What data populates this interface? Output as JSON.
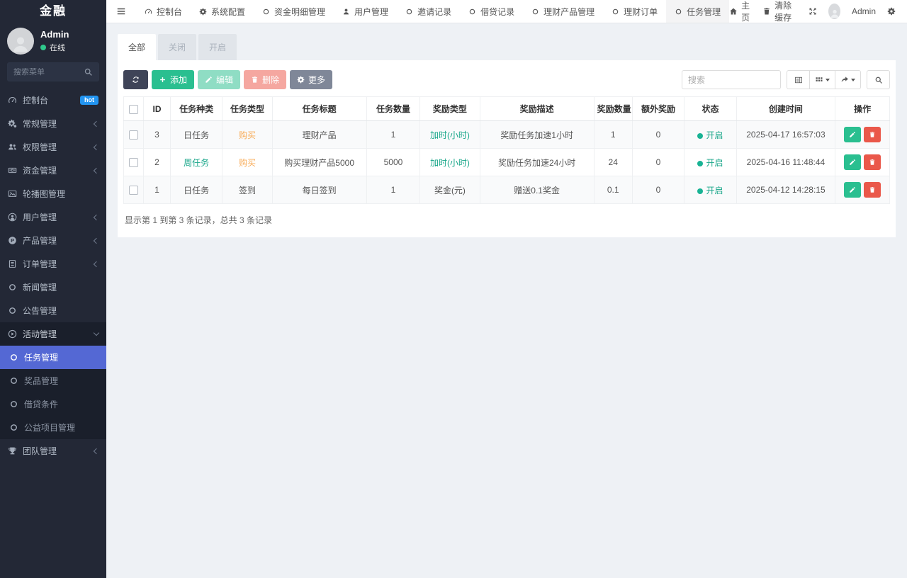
{
  "app": {
    "title": "金融"
  },
  "colors": {
    "accent_green": "#2abf90",
    "accent_red": "#ec584b",
    "accent_orange": "#f8ac59",
    "active_blue": "#5468d4",
    "hot_badge_blue": "#2395f1",
    "status_green": "#18a689",
    "sidebar_bg": "#232836"
  },
  "sidebar": {
    "user": {
      "name": "Admin",
      "status": "在线"
    },
    "search_placeholder": "搜索菜单",
    "items": [
      {
        "id": "dashboard",
        "label": "控制台",
        "icon": "dashboard-icon",
        "badge": "hot"
      },
      {
        "id": "general",
        "label": "常规管理",
        "icon": "cogs-icon",
        "chevron": "left"
      },
      {
        "id": "permission",
        "label": "权限管理",
        "icon": "users-icon",
        "chevron": "left"
      },
      {
        "id": "funds",
        "label": "资金管理",
        "icon": "money-icon",
        "chevron": "left"
      },
      {
        "id": "banner",
        "label": "轮播图管理",
        "icon": "image-icon"
      },
      {
        "id": "users",
        "label": "用户管理",
        "icon": "user-circle-icon",
        "chevron": "left"
      },
      {
        "id": "products",
        "label": "产品管理",
        "icon": "product-icon",
        "chevron": "left"
      },
      {
        "id": "orders",
        "label": "订单管理",
        "icon": "order-icon",
        "chevron": "left"
      },
      {
        "id": "news",
        "label": "新闻管理",
        "icon": "circle-icon"
      },
      {
        "id": "notice",
        "label": "公告管理",
        "icon": "circle-icon"
      },
      {
        "id": "activity",
        "label": "活动管理",
        "icon": "play-circle-icon",
        "chevron": "down",
        "expanded": true,
        "children": [
          {
            "id": "tasks",
            "label": "任务管理",
            "icon": "circle-icon",
            "active": true
          },
          {
            "id": "prizes",
            "label": "奖品管理",
            "icon": "circle-icon"
          },
          {
            "id": "loan-terms",
            "label": "借贷条件",
            "icon": "circle-icon"
          },
          {
            "id": "charity",
            "label": "公益项目管理",
            "icon": "circle-icon"
          }
        ]
      },
      {
        "id": "team",
        "label": "团队管理",
        "icon": "trophy-icon",
        "chevron": "left"
      }
    ]
  },
  "topnav": {
    "tabs": [
      {
        "id": "dashboard",
        "label": "控制台",
        "icon": "dashboard-icon"
      },
      {
        "id": "system-config",
        "label": "系统配置",
        "icon": "gear-icon"
      },
      {
        "id": "fund-details",
        "label": "资金明细管理",
        "icon": "circle-icon"
      },
      {
        "id": "user-mgmt",
        "label": "用户管理",
        "icon": "person-icon"
      },
      {
        "id": "invite-records",
        "label": "邀请记录",
        "icon": "circle-icon"
      },
      {
        "id": "loan-records",
        "label": "借贷记录",
        "icon": "circle-icon"
      },
      {
        "id": "wealth-products",
        "label": "理财产品管理",
        "icon": "circle-icon"
      },
      {
        "id": "wealth-orders",
        "label": "理财订单",
        "icon": "circle-icon"
      },
      {
        "id": "task-mgmt",
        "label": "任务管理",
        "icon": "circle-icon",
        "active": true
      }
    ],
    "right": {
      "home": "主页",
      "clear_cache": "清除缓存",
      "user": "Admin"
    }
  },
  "filter_tabs": [
    {
      "id": "all",
      "label": "全部",
      "active": true
    },
    {
      "id": "closed",
      "label": "关闭",
      "active": false
    },
    {
      "id": "open",
      "label": "开启",
      "active": false
    }
  ],
  "toolbar": {
    "add": "添加",
    "edit": "编辑",
    "delete": "删除",
    "more": "更多",
    "search_placeholder": "搜索"
  },
  "table": {
    "columns": [
      "ID",
      "任务种类",
      "任务类型",
      "任务标题",
      "任务数量",
      "奖励类型",
      "奖励描述",
      "奖励数量",
      "额外奖励",
      "状态",
      "创建时间",
      "操作"
    ],
    "status_label": "开启",
    "rows": [
      {
        "id": "3",
        "kind": "日任务",
        "kind_color": "",
        "type": "购买",
        "type_color": "orange",
        "title": "理财产品",
        "count": "1",
        "reward_type": "加时(小时)",
        "reward_type_color": "green",
        "reward_desc": "奖励任务加速1小时",
        "reward_count": "1",
        "extra": "0",
        "status": "开启",
        "created": "2025-04-17 16:57:03"
      },
      {
        "id": "2",
        "kind": "周任务",
        "kind_color": "green",
        "type": "购买",
        "type_color": "orange",
        "title": "购买理财产品5000",
        "count": "5000",
        "reward_type": "加时(小时)",
        "reward_type_color": "green",
        "reward_desc": "奖励任务加速24小时",
        "reward_count": "24",
        "extra": "0",
        "status": "开启",
        "created": "2025-04-16 11:48:44"
      },
      {
        "id": "1",
        "kind": "日任务",
        "kind_color": "",
        "type": "签到",
        "type_color": "",
        "title": "每日签到",
        "count": "1",
        "reward_type": "奖金(元)",
        "reward_type_color": "",
        "reward_desc": "赠送0.1奖金",
        "reward_count": "0.1",
        "extra": "0",
        "status": "开启",
        "created": "2025-04-12 14:28:15"
      }
    ],
    "summary": "显示第 1 到第 3 条记录，总共 3 条记录"
  }
}
